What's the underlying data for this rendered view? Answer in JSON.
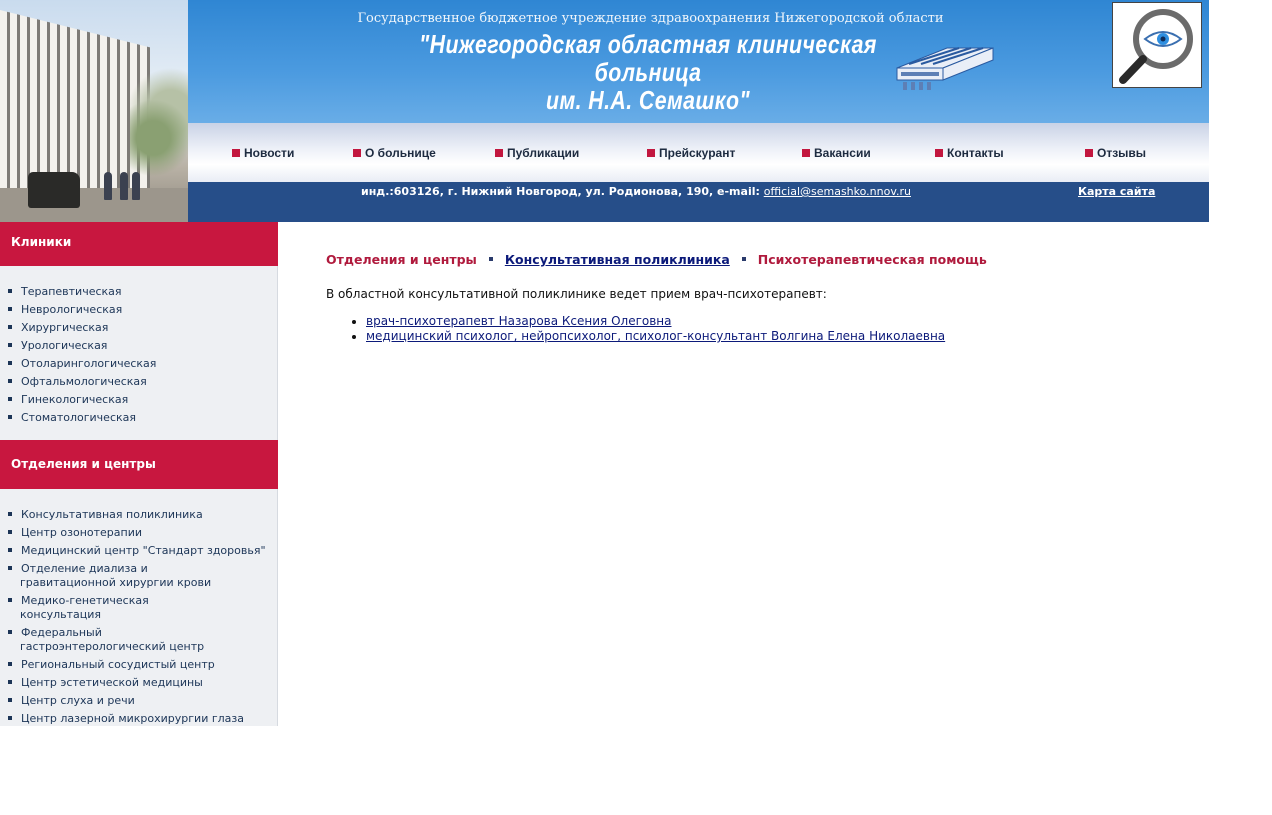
{
  "header": {
    "org_subtitle": "Государственное бюджетное учреждение здравоохранения Нижегородской области",
    "org_title_line1": "\"Нижегородская областная клиническая больница",
    "org_title_line2": "им. Н.А. Семашко\"",
    "accessibility_icon": "magnifier-eye-icon"
  },
  "nav": {
    "items": [
      "Новости",
      "О больнице",
      "Публикации",
      "Прейскурант",
      "Вакансии",
      "Контакты",
      "Отзывы"
    ]
  },
  "info_bar": {
    "address": "инд.:603126, г. Нижний Новгород, ул. Родионова, 190, e-mail:",
    "email": "official@semashko.nnov.ru",
    "sitemap": "Карта сайта"
  },
  "sidebar": {
    "clinics_title": "Клиники",
    "clinics": [
      "Терапевтическая",
      "Неврологическая",
      "Хирургическая",
      "Урологическая",
      "Отоларингологическая",
      "Офтальмологическая",
      "Гинекологическая",
      "Стоматологическая"
    ],
    "departments_title": "Отделения и центры",
    "departments": [
      [
        "Консультативная поликлиника"
      ],
      [
        "Центр озонотерапии"
      ],
      [
        "Медицинский центр \"Стандарт здоровья\""
      ],
      [
        "Отделение диализа и",
        "гравитационной хирургии крови"
      ],
      [
        "Медико-генетическая",
        "консультация"
      ],
      [
        "Федеральный",
        "гастроэнтерологический центр"
      ],
      [
        "Региональный сосудистый центр"
      ],
      [
        "Центр эстетической медицины"
      ],
      [
        "Центр слуха и речи"
      ],
      [
        "Центр лазерной микрохирургии глаза"
      ]
    ]
  },
  "content": {
    "breadcrumb": {
      "first": "Отделения и центры",
      "second": "Консультативная поликлиника",
      "current": "Психотерапевтическая помощь"
    },
    "intro": "В областной консультативной поликлинике ведет прием врач-психотерапевт:",
    "staff": [
      "врач-психотерапевт Назарова Ксения Олеговна",
      "медицинский психолог, нейропсихолог, психолог-консультант Волгина Елена Николаевна"
    ]
  },
  "colors": {
    "accent": "#c8173f",
    "nav_dark": "#264e89",
    "banner_blue": "#2f86d3",
    "link": "#0c1a7a"
  }
}
